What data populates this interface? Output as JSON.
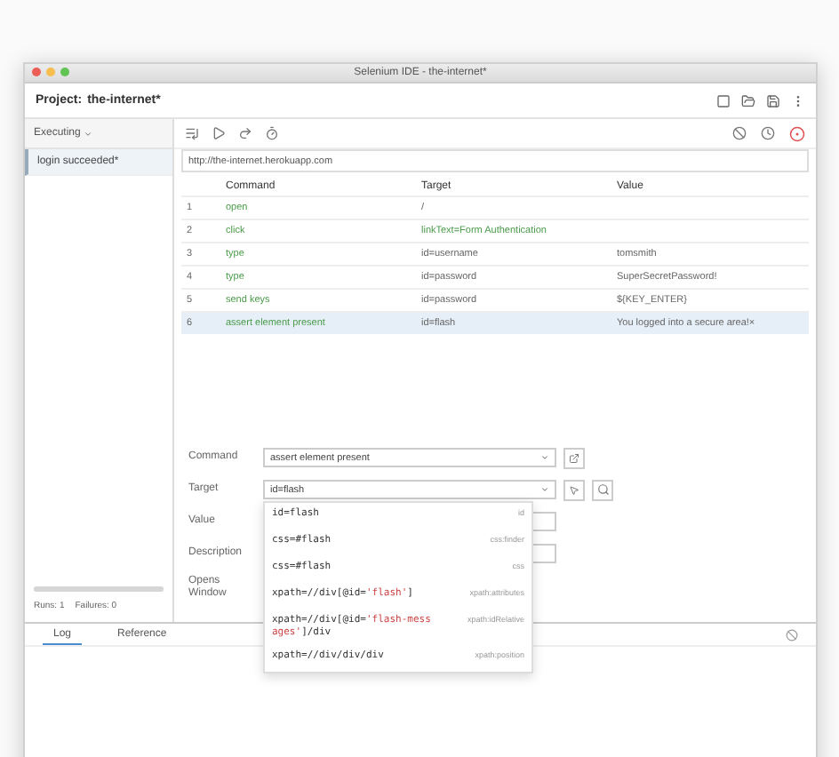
{
  "window": {
    "title": "Selenium IDE - the-internet*"
  },
  "project": {
    "label": "Project:",
    "name": "the-internet*"
  },
  "sidebar": {
    "dropdown": "Executing",
    "items": [
      {
        "label": "login succeeded*",
        "selected": true
      }
    ],
    "progress": {
      "level": 1
    },
    "runs": "Runs: 1",
    "failures": "Failures: 0"
  },
  "url": "http://the-internet.herokuapp.com",
  "table": {
    "columns": [
      "Command",
      "Target",
      "Value"
    ],
    "rows": [
      {
        "index": "1",
        "command": "open",
        "target": "/",
        "selected": false
      },
      {
        "index": "2",
        "command": "click",
        "target": "linkText=Form Authentication",
        "selected": false
      },
      {
        "index": "3",
        "command": "type",
        "target": "id=username",
        "value": "tomsmith",
        "selected": false
      },
      {
        "index": "4",
        "command": "type",
        "target": "id=password",
        "value": "SuperSecretPassword!",
        "selected": false
      },
      {
        "index": "5",
        "command": "send keys",
        "target": "id=password",
        "value": "${KEY_ENTER}",
        "selected": false
      },
      {
        "index": "6",
        "command": "assert element present",
        "target": "id=flash",
        "value": "You logged into a secure area!×",
        "selected": true
      }
    ]
  },
  "editor": {
    "fields": [
      {
        "label": "Command",
        "kind": "select",
        "value": "assert element present"
      },
      {
        "label": "Target",
        "kind": "target",
        "value": "id=flash"
      },
      {
        "label": "Value",
        "kind": "text"
      },
      {
        "label": "Description",
        "kind": "text"
      },
      {
        "label": "Opens Window",
        "kind": "none"
      }
    ]
  },
  "locator_menu": {
    "items": [
      {
        "strategy": "id",
        "parts": [
          {
            "kind": "plain",
            "text": "id=flash"
          }
        ]
      },
      {
        "strategy": "css:finder",
        "parts": [
          {
            "kind": "plain",
            "text": "css=#flash"
          }
        ]
      },
      {
        "strategy": "css",
        "parts": [
          {
            "kind": "plain",
            "text": "css=#flash"
          }
        ]
      },
      {
        "strategy": "xpath:attributes",
        "parts": [
          {
            "kind": "plain",
            "text": "xpath=//div[@id="
          },
          {
            "kind": "string",
            "text": "'flash'"
          },
          {
            "kind": "plain",
            "text": "]"
          }
        ]
      },
      {
        "strategy": "xpath:idRelative",
        "parts": [
          {
            "kind": "plain",
            "text": "xpath=//div[@id="
          },
          {
            "kind": "string",
            "text": "'flash-messages'"
          },
          {
            "kind": "plain",
            "text": "]/div"
          }
        ]
      },
      {
        "strategy": "xpath:position",
        "parts": [
          {
            "kind": "plain",
            "text": "xpath=//div/div/div"
          }
        ]
      }
    ]
  },
  "bottom_panel": {
    "tabs": [
      {
        "label": "Log",
        "selected": true
      },
      {
        "label": "Reference",
        "selected": false
      }
    ]
  }
}
